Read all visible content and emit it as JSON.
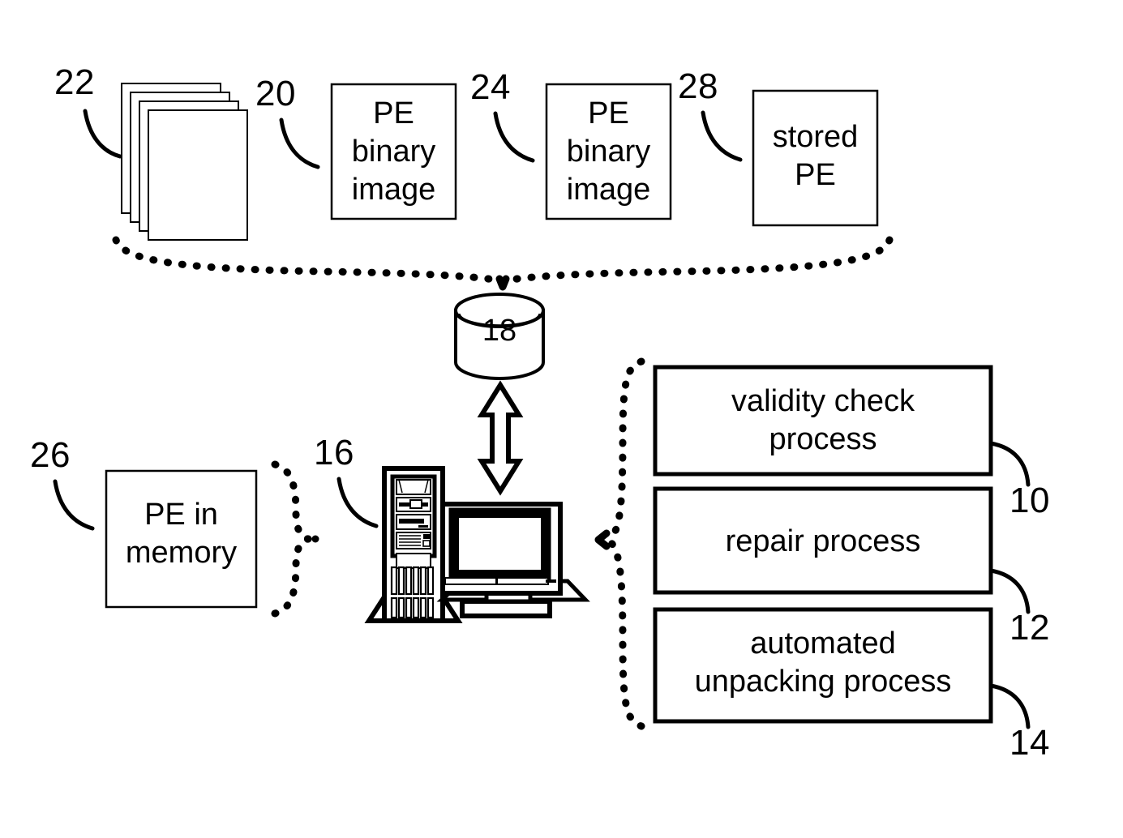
{
  "figure": {
    "type": "patent-system-diagram",
    "background_color": "#ffffff",
    "line_color": "#000000"
  },
  "sources": {
    "stack": {
      "ref": "22",
      "icon": "document-stack-icon",
      "sheets": 4
    },
    "boxes": [
      {
        "ref": "20",
        "line1": "PE",
        "line2": "binary",
        "line3": "image"
      },
      {
        "ref": "24",
        "line1": "PE",
        "line2": "binary",
        "line3": "image"
      },
      {
        "ref": "28",
        "line1": "stored",
        "line2": "PE",
        "line3": ""
      }
    ]
  },
  "storage": {
    "ref": "18",
    "icon": "database-cylinder-icon"
  },
  "computer": {
    "ref": "16",
    "icon": "desktop-computer-icon"
  },
  "memory": {
    "ref": "26",
    "line1": "PE in",
    "line2": "memory"
  },
  "processes": [
    {
      "ref": "10",
      "line1": "validity check",
      "line2": "process"
    },
    {
      "ref": "12",
      "line1": "repair process",
      "line2": ""
    },
    {
      "ref": "14",
      "line1": "automated",
      "line2": "unpacking process"
    }
  ],
  "connectors": {
    "top_brace": "dotted-curly-brace-down",
    "side_brace": "dotted-curly-brace-left",
    "memory_brace": "dotted-curly-brace-right",
    "db_arrow": "double-headed-vertical-arrow"
  }
}
